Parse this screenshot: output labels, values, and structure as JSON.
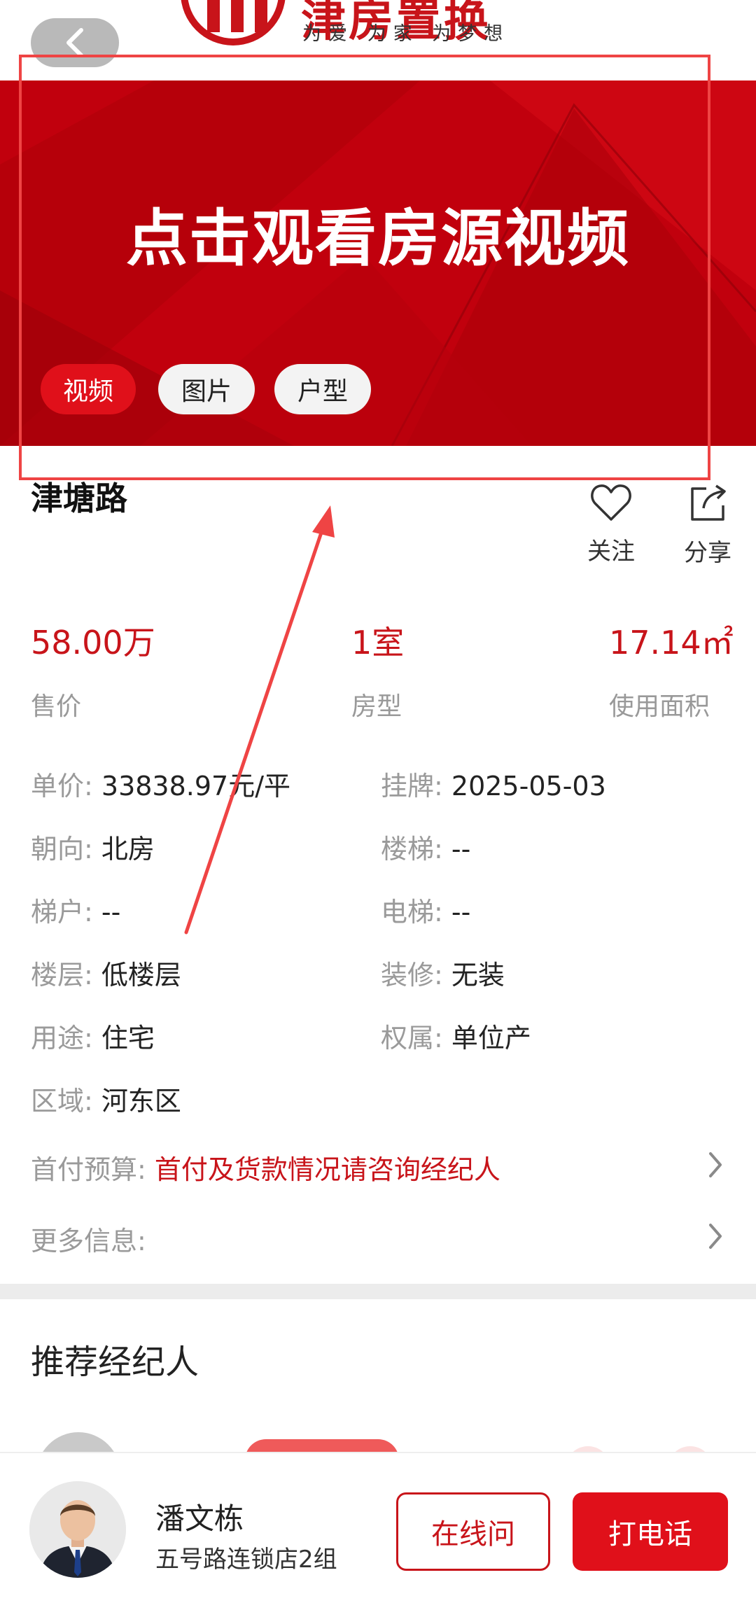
{
  "header": {
    "logo_text": "津房置换",
    "slogan": "为爱 为家 为梦想",
    "back_icon": "chevron-left-icon"
  },
  "hero": {
    "title": "点击观看房源视频",
    "tabs": [
      {
        "label": "视频",
        "active": true
      },
      {
        "label": "图片",
        "active": false
      },
      {
        "label": "户型",
        "active": false
      }
    ],
    "bg_color": "#c1000d"
  },
  "listing": {
    "title": "津塘路",
    "follow_label": "关注",
    "share_label": "分享"
  },
  "stats": [
    {
      "value": "58.00万",
      "label": "售价"
    },
    {
      "value": "1室",
      "label": "房型"
    },
    {
      "value": "17.14㎡",
      "label": "使用面积"
    }
  ],
  "details": {
    "unit_price": {
      "key": "单价:",
      "value": "33838.97元/平"
    },
    "listed": {
      "key": "挂牌:",
      "value": "2025-05-03"
    },
    "orientation": {
      "key": "朝向:",
      "value": "北房"
    },
    "stairs": {
      "key": "楼梯:",
      "value": "--"
    },
    "ladder_household": {
      "key": "梯户:",
      "value": "--"
    },
    "elevator": {
      "key": "电梯:",
      "value": "--"
    },
    "floor": {
      "key": "楼层:",
      "value": "低楼层"
    },
    "decoration": {
      "key": "装修:",
      "value": "无装"
    },
    "usage": {
      "key": "用途:",
      "value": "住宅"
    },
    "ownership": {
      "key": "权属:",
      "value": "单位产"
    },
    "district": {
      "key": "区域:",
      "value": "河东区"
    }
  },
  "down_payment": {
    "key": "首付预算:",
    "value": "首付及货款情况请咨询经纪人"
  },
  "more_info": {
    "key": "更多信息:"
  },
  "recommend": {
    "title": "推荐经纪人"
  },
  "agent": {
    "name": "潘文栋",
    "store": "五号路连锁店2组",
    "online_label": "在线问",
    "call_label": "打电话"
  },
  "colors": {
    "accent": "#c8141a",
    "annotation": "#ef4444"
  }
}
